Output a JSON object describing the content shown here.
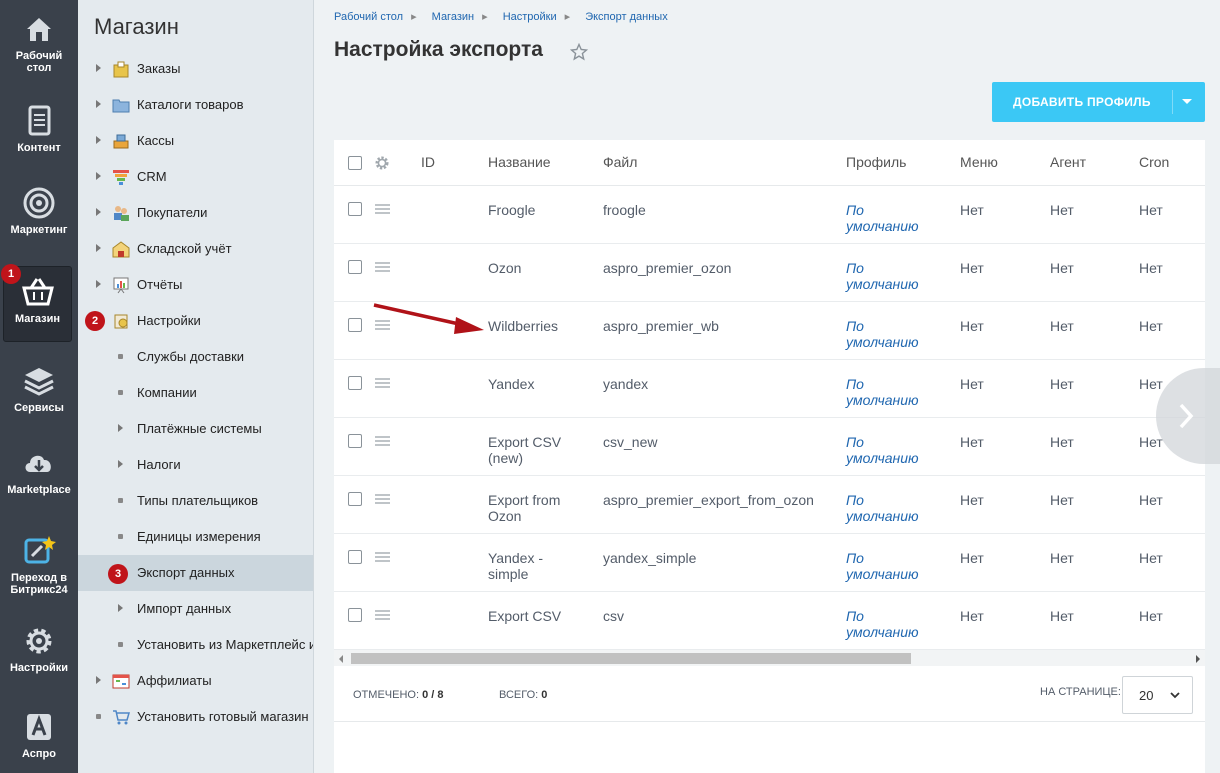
{
  "leftbar": {
    "items": [
      {
        "label_line1": "Рабочий",
        "label_line2": "стол",
        "icon": "home-icon"
      },
      {
        "label_line1": "Контент",
        "label_line2": "",
        "icon": "document-icon"
      },
      {
        "label_line1": "Маркетинг",
        "label_line2": "",
        "icon": "target-icon"
      },
      {
        "label_line1": "Магазин",
        "label_line2": "",
        "icon": "basket-icon",
        "badge": "1"
      },
      {
        "label_line1": "Сервисы",
        "label_line2": "",
        "icon": "layers-icon"
      },
      {
        "label_line1": "Marketplace",
        "label_line2": "",
        "icon": "cloud-download-icon"
      },
      {
        "label_line1": "Переход в",
        "label_line2": "Битрикс24",
        "icon": "bitrix24-icon"
      },
      {
        "label_line1": "Настройки",
        "label_line2": "",
        "icon": "gear-icon"
      },
      {
        "label_line1": "Аспро",
        "label_line2": "",
        "icon": "aspro-icon"
      }
    ]
  },
  "menu": {
    "title": "Магазин",
    "items": [
      {
        "label": "Заказы",
        "icon": "orders-icon"
      },
      {
        "label": "Каталоги товаров",
        "icon": "folder-icon"
      },
      {
        "label": "Кассы",
        "icon": "cashbox-icon"
      },
      {
        "label": "CRM",
        "icon": "crm-icon"
      },
      {
        "label": "Покупатели",
        "icon": "users-icon"
      },
      {
        "label": "Складской учёт",
        "icon": "warehouse-icon"
      },
      {
        "label": "Отчёты",
        "icon": "report-icon"
      },
      {
        "label": "Настройки",
        "icon": "settings-icon",
        "badge": "2"
      },
      {
        "label": "Службы доставки"
      },
      {
        "label": "Компании"
      },
      {
        "label": "Платёжные системы"
      },
      {
        "label": "Налоги"
      },
      {
        "label": "Типы плательщиков"
      },
      {
        "label": "Единицы измерения"
      },
      {
        "label": "Экспорт данных",
        "badge": "3"
      },
      {
        "label": "Импорт данных"
      },
      {
        "label": "Установить из Маркетплейс и"
      },
      {
        "label": "Аффилиаты",
        "icon": "affiliates-icon"
      },
      {
        "label": "Установить готовый магазин",
        "icon": "cart-icon"
      }
    ]
  },
  "breadcrumbs": [
    "Рабочий стол",
    "Магазин",
    "Настройки",
    "Экспорт данных"
  ],
  "page_title": "Настройка экспорта",
  "add_button": {
    "label": "ДОБАВИТЬ ПРОФИЛЬ"
  },
  "grid": {
    "columns": [
      "ID",
      "Название",
      "Файл",
      "Профиль",
      "Меню",
      "Агент",
      "Cron"
    ],
    "rows": [
      {
        "id": "",
        "name_l1": "Froogle",
        "name_l2": "",
        "file": "froogle",
        "profile_l1": "По",
        "profile_l2": "умолчанию",
        "menu": "Нет",
        "agent": "Нет",
        "cron": "Нет"
      },
      {
        "id": "",
        "name_l1": "Ozon",
        "name_l2": "",
        "file": "aspro_premier_ozon",
        "profile_l1": "По",
        "profile_l2": "умолчанию",
        "menu": "Нет",
        "agent": "Нет",
        "cron": "Нет"
      },
      {
        "id": "",
        "name_l1": "Wildberries",
        "name_l2": "",
        "file": "aspro_premier_wb",
        "profile_l1": "По",
        "profile_l2": "умолчанию",
        "menu": "Нет",
        "agent": "Нет",
        "cron": "Нет"
      },
      {
        "id": "",
        "name_l1": "Yandex",
        "name_l2": "",
        "file": "yandex",
        "profile_l1": "По",
        "profile_l2": "умолчанию",
        "menu": "Нет",
        "agent": "Нет",
        "cron": "Нет"
      },
      {
        "id": "",
        "name_l1": "Export CSV",
        "name_l2": "(new)",
        "file": "csv_new",
        "profile_l1": "По",
        "profile_l2": "умолчанию",
        "menu": "Нет",
        "agent": "Нет",
        "cron": "Нет"
      },
      {
        "id": "",
        "name_l1": "Export from",
        "name_l2": "Ozon",
        "file": "aspro_premier_export_from_ozon",
        "profile_l1": "По",
        "profile_l2": "умолчанию",
        "menu": "Нет",
        "agent": "Нет",
        "cron": "Нет"
      },
      {
        "id": "",
        "name_l1": "Yandex -",
        "name_l2": "simple",
        "file": "yandex_simple",
        "profile_l1": "По",
        "profile_l2": "умолчанию",
        "menu": "Нет",
        "agent": "Нет",
        "cron": "Нет"
      },
      {
        "id": "",
        "name_l1": "Export CSV",
        "name_l2": "",
        "file": "csv",
        "profile_l1": "По",
        "profile_l2": "умолчанию",
        "menu": "Нет",
        "agent": "Нет",
        "cron": "Нет"
      }
    ]
  },
  "footer": {
    "checked_label": "ОТМЕЧЕНО:",
    "checked_value": "0 / 8",
    "total_label": "ВСЕГО:",
    "total_value": "0",
    "per_page_label": "НА СТРАНИЦЕ:",
    "per_page_value": "20"
  },
  "colors": {
    "accent": "#3bc8f5",
    "badge": "#c0141a",
    "link": "#2067b0"
  }
}
